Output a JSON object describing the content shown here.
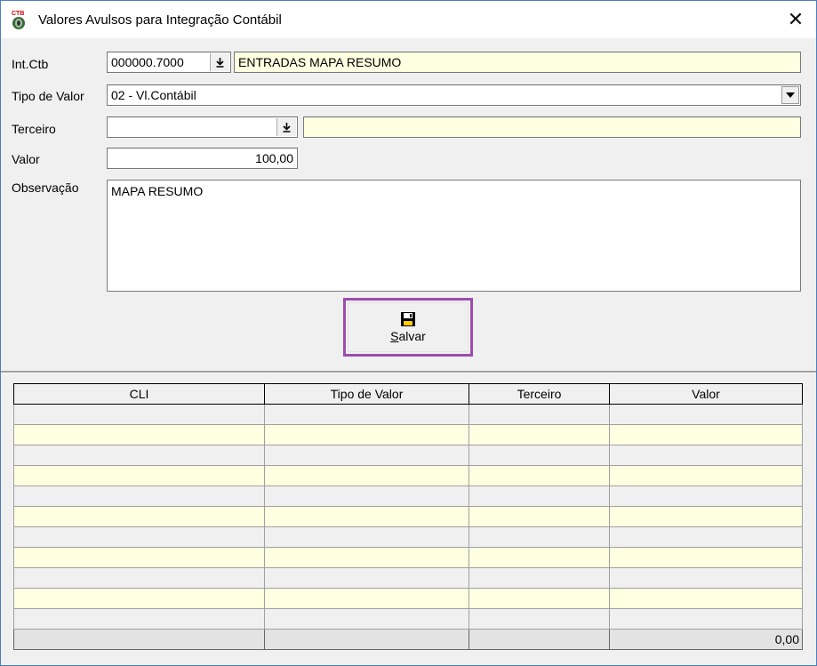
{
  "window": {
    "title": "Valores Avulsos para Integração Contábil",
    "close_glyph": "✕"
  },
  "form": {
    "int_ctb": {
      "label": "Int.Ctb",
      "value": "000000.7000",
      "description": "ENTRADAS MAPA RESUMO",
      "lookup_icon": "arrow-down-icon"
    },
    "tipo_valor": {
      "label": "Tipo de Valor",
      "value": "02 - Vl.Contábil"
    },
    "terceiro": {
      "label": "Terceiro",
      "value": "",
      "description": ""
    },
    "valor": {
      "label": "Valor",
      "value": "100,00"
    },
    "observacao": {
      "label": "Observação",
      "value": "MAPA RESUMO"
    }
  },
  "save_button": {
    "label_mnemonic": "S",
    "label_rest": "alvar",
    "icon": "floppy-disk-icon"
  },
  "grid": {
    "columns": [
      "CLI",
      "Tipo de Valor",
      "Terceiro",
      "Valor"
    ],
    "row_count": 11,
    "totals": [
      "",
      "",
      "",
      "0,00"
    ]
  },
  "colors": {
    "accent_border": "#9b4db1",
    "alt_row": "#ffffe1",
    "window_bg": "#f0f0f0"
  }
}
